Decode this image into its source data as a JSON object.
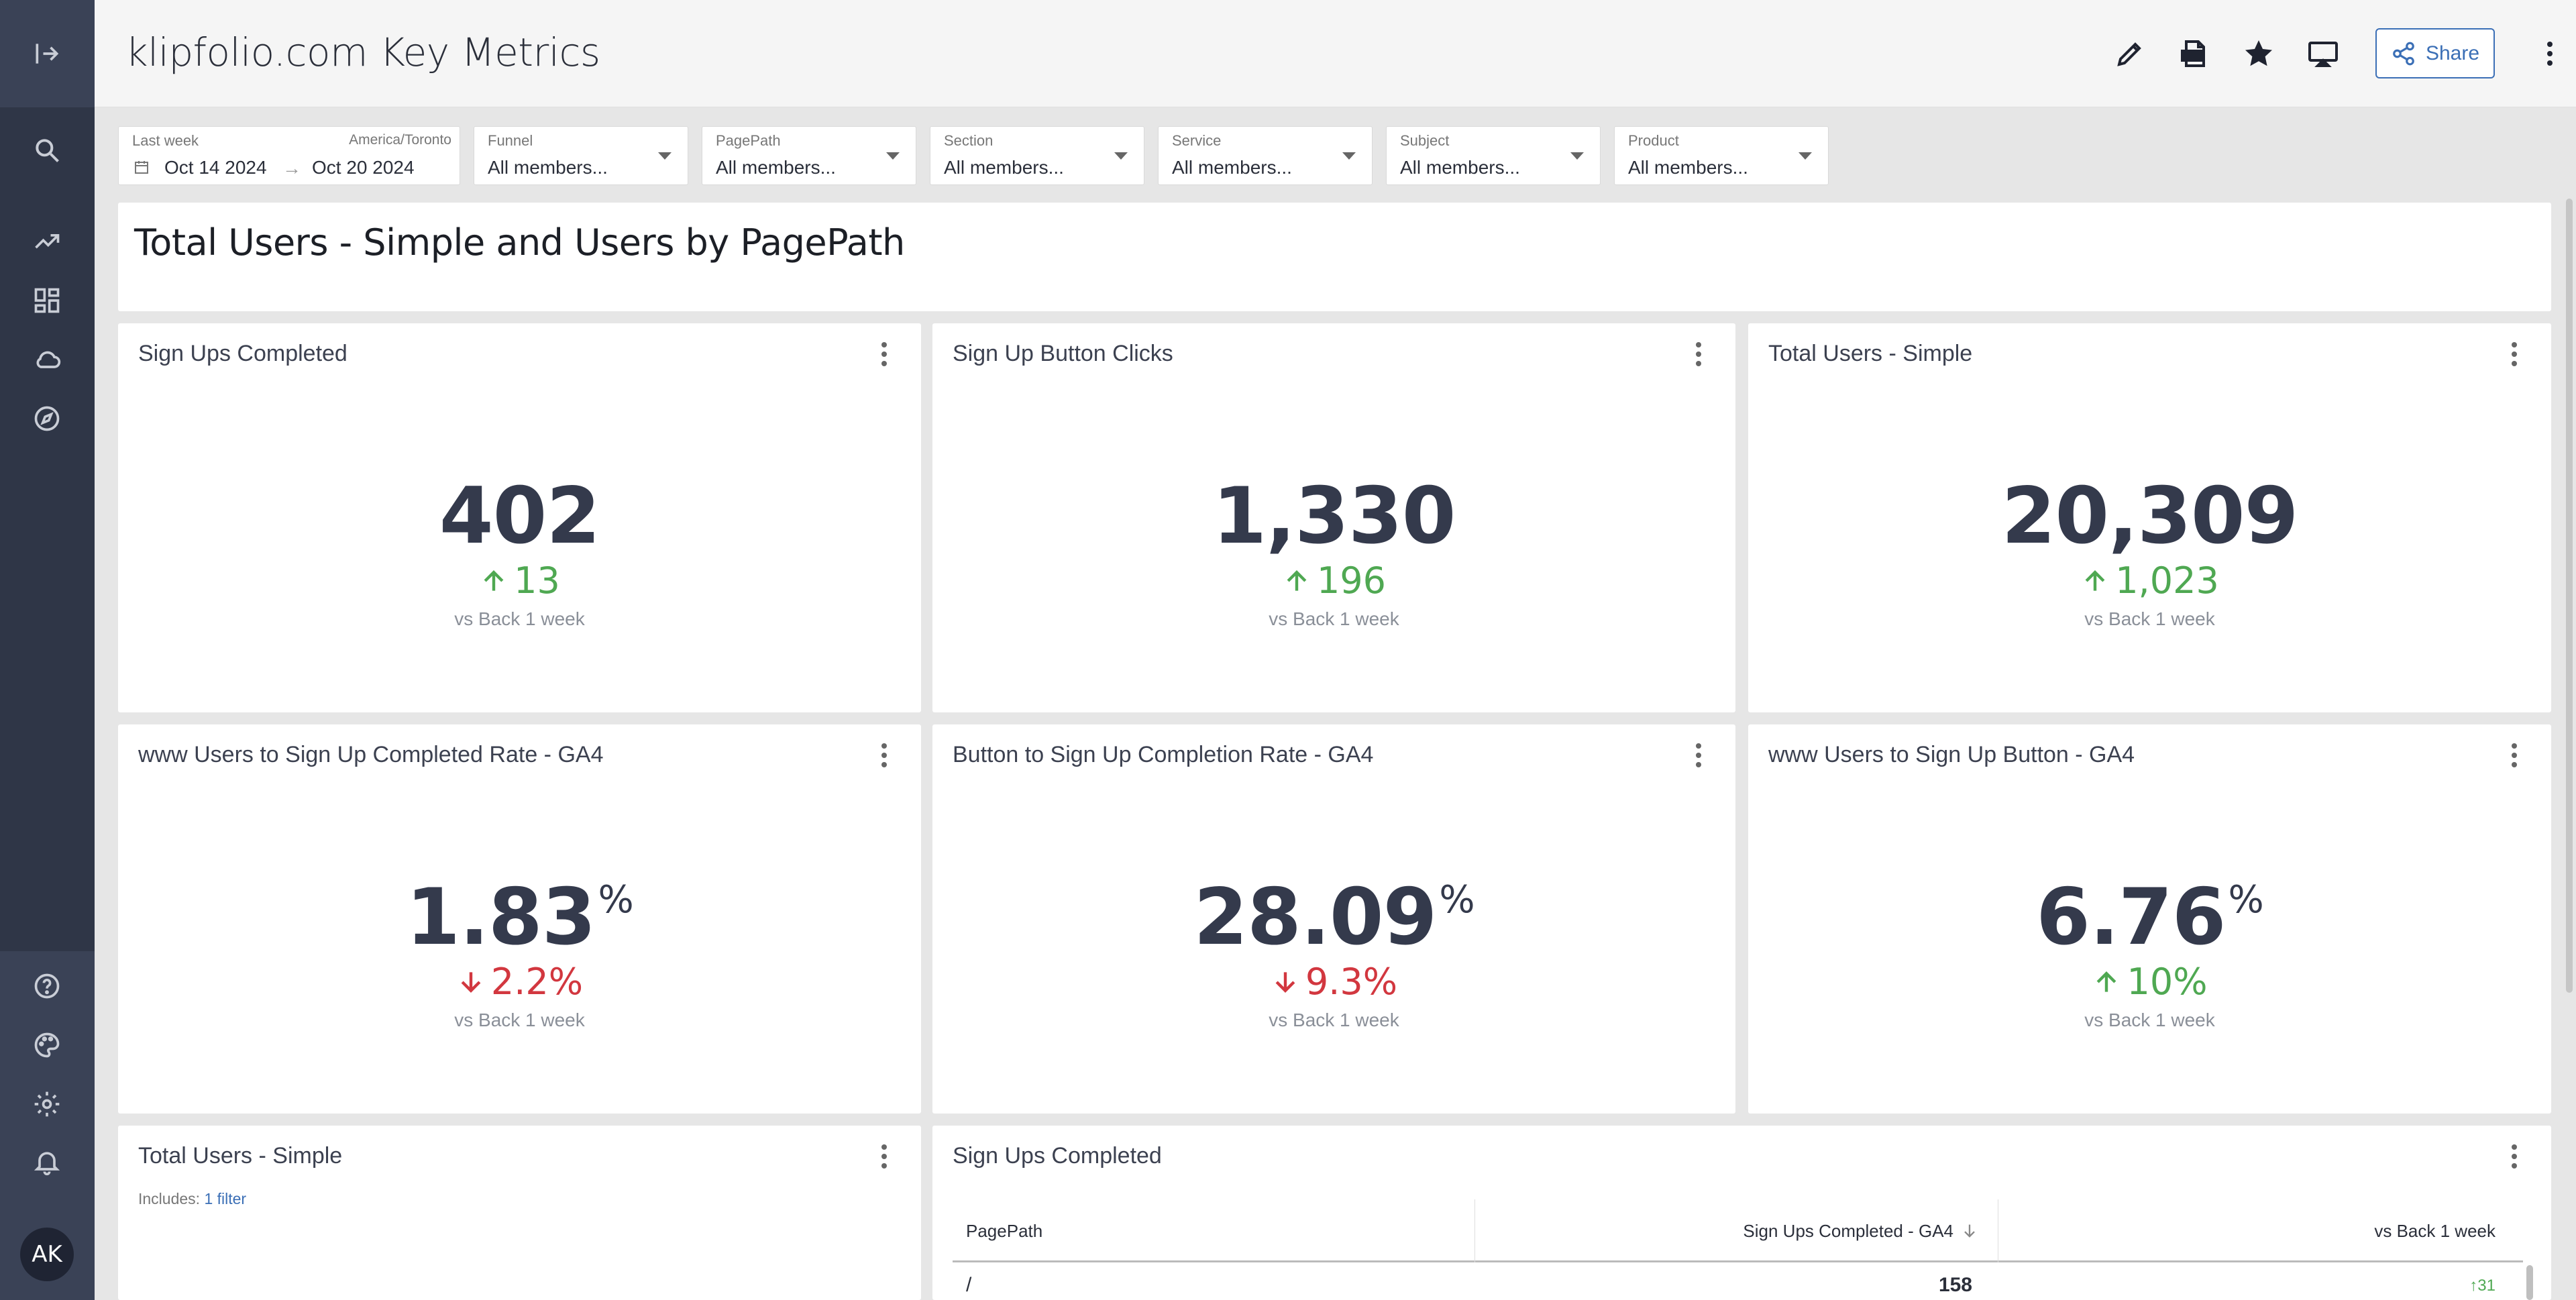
{
  "header": {
    "title": "klipfolio.com Key Metrics",
    "share_label": "Share"
  },
  "rail": {
    "avatar_initials": "AK"
  },
  "filters": {
    "date": {
      "label": "Last week",
      "timezone": "America/Toronto",
      "start": "Oct 14 2024",
      "end": "Oct 20 2024"
    },
    "dropdowns": [
      {
        "label": "Funnel",
        "value": "All members..."
      },
      {
        "label": "PagePath",
        "value": "All members..."
      },
      {
        "label": "Section",
        "value": "All members..."
      },
      {
        "label": "Service",
        "value": "All members..."
      },
      {
        "label": "Subject",
        "value": "All members..."
      },
      {
        "label": "Product",
        "value": "All members..."
      }
    ]
  },
  "banner": {
    "title": "Total Users - Simple and Users by PagePath"
  },
  "metrics": [
    {
      "title": "Sign Ups Completed",
      "value": "402",
      "unit": "",
      "delta": "13",
      "direction": "up",
      "comparison": "vs Back 1 week"
    },
    {
      "title": "Sign Up Button Clicks",
      "value": "1,330",
      "unit": "",
      "delta": "196",
      "direction": "up",
      "comparison": "vs Back 1 week"
    },
    {
      "title": "Total Users - Simple",
      "value": "20,309",
      "unit": "",
      "delta": "1,023",
      "direction": "up",
      "comparison": "vs Back 1 week"
    },
    {
      "title": "www Users to Sign Up Completed Rate - GA4",
      "value": "1.83",
      "unit": "%",
      "delta": "2.2%",
      "direction": "down",
      "comparison": "vs Back 1 week"
    },
    {
      "title": "Button to Sign Up Completion Rate - GA4",
      "value": "28.09",
      "unit": "%",
      "delta": "9.3%",
      "direction": "down",
      "comparison": "vs Back 1 week"
    },
    {
      "title": "www Users to Sign Up Button - GA4",
      "value": "6.76",
      "unit": "%",
      "delta": "10%",
      "direction": "up",
      "comparison": "vs Back 1 week"
    }
  ],
  "bottom_left": {
    "title": "Total Users - Simple",
    "includes_label": "Includes:",
    "includes_link": "1 filter"
  },
  "bottom_right": {
    "title": "Sign Ups Completed",
    "columns": [
      "PagePath",
      "Sign Ups Completed - GA4",
      "vs Back 1 week"
    ],
    "rows": [
      {
        "pagepath": "/",
        "value": "158",
        "delta": "31"
      }
    ]
  },
  "colors": {
    "rail": "#2f3647",
    "up": "#4fa852",
    "down": "#d2373f",
    "accent": "#3b6fb6"
  }
}
